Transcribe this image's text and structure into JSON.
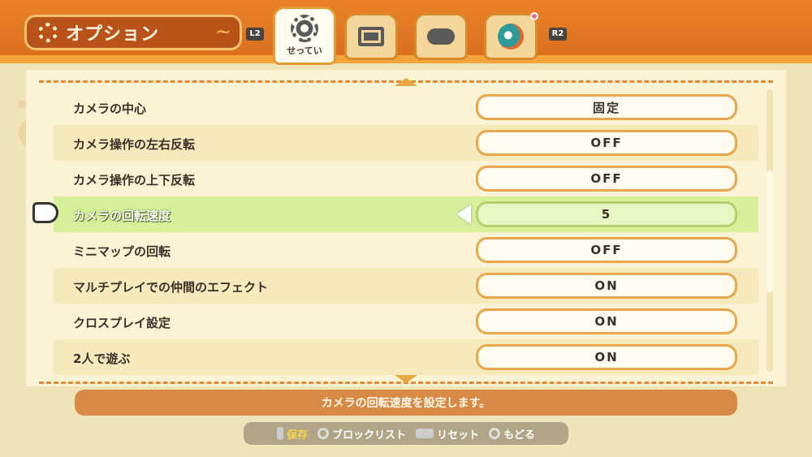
{
  "header": {
    "title": "オプション",
    "title_icon": "gear-icon",
    "left_shoulder": "L2",
    "right_shoulder": "R2",
    "tabs": [
      {
        "label": "せってい",
        "icon": "gear-icon",
        "active": true
      },
      {
        "label": "",
        "icon": "monitor-icon",
        "active": false
      },
      {
        "label": "",
        "icon": "gamepad-icon",
        "active": false
      },
      {
        "label": "",
        "icon": "character-icon",
        "active": false
      }
    ]
  },
  "settings": [
    {
      "label": "カメラの中心",
      "value": "固定"
    },
    {
      "label": "カメラ操作の左右反転",
      "value": "OFF"
    },
    {
      "label": "カメラ操作の上下反転",
      "value": "OFF"
    },
    {
      "label": "カメラの回転速度",
      "value": "5"
    },
    {
      "label": "ミニマップの回転",
      "value": "OFF"
    },
    {
      "label": "マルチプレイでの仲間のエフェクト",
      "value": "ON"
    },
    {
      "label": "クロスプレイ設定",
      "value": "ON"
    },
    {
      "label": "2人で遊ぶ",
      "value": "ON"
    }
  ],
  "description": "カメラの回転速度を設定します。",
  "footer": {
    "save": "保存",
    "blocklist": "ブロックリスト",
    "reset": "リセット",
    "back": "もどる"
  },
  "colors": {
    "header_orange": "#e8822a",
    "selected_row": "#d6f09a",
    "value_border": "#e8a74a"
  }
}
